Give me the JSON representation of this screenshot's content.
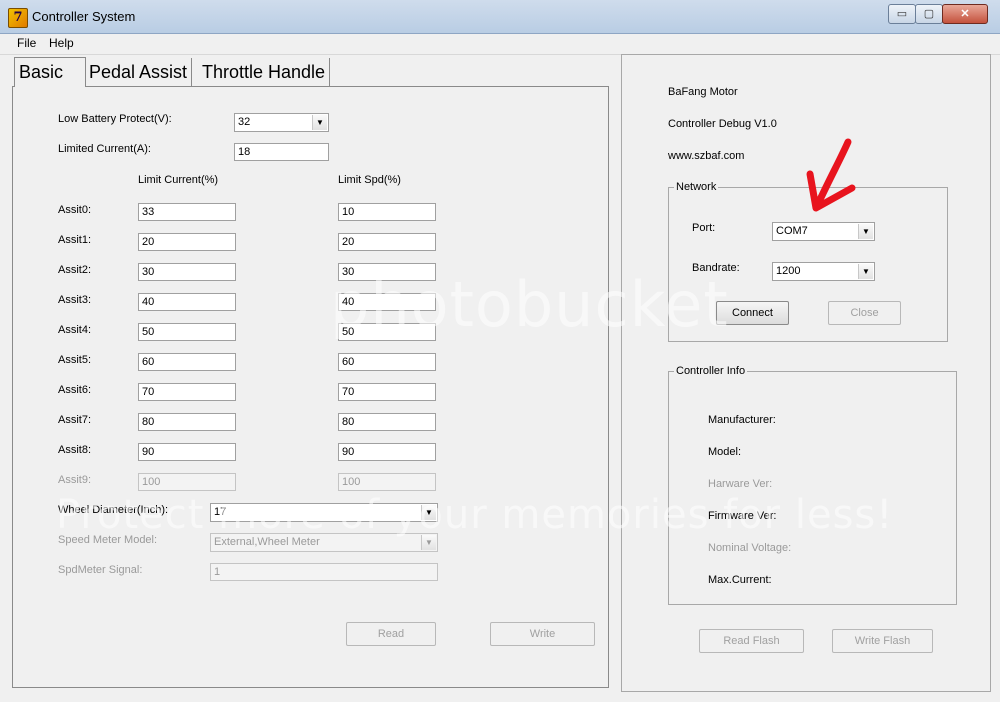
{
  "window": {
    "title": "Controller System",
    "min": "▭",
    "max": "▢",
    "close": "✕"
  },
  "menu": [
    "File",
    "Help"
  ],
  "tabs": [
    "Basic",
    "Pedal Assist",
    "Throttle Handle"
  ],
  "basic": {
    "low_battery_label": "Low Battery Protect(V):",
    "low_battery_value": "32",
    "limited_current_label": "Limited Current(A):",
    "limited_current_value": "18",
    "col_current": "Limit Current(%)",
    "col_speed": "Limit Spd(%)",
    "assist": [
      {
        "label": "Assit0:",
        "current": "33",
        "speed": "10"
      },
      {
        "label": "Assit1:",
        "current": "20",
        "speed": "20"
      },
      {
        "label": "Assit2:",
        "current": "30",
        "speed": "30"
      },
      {
        "label": "Assit3:",
        "current": "40",
        "speed": "40"
      },
      {
        "label": "Assit4:",
        "current": "50",
        "speed": "50"
      },
      {
        "label": "Assit5:",
        "current": "60",
        "speed": "60"
      },
      {
        "label": "Assit6:",
        "current": "70",
        "speed": "70"
      },
      {
        "label": "Assit7:",
        "current": "80",
        "speed": "80"
      },
      {
        "label": "Assit8:",
        "current": "90",
        "speed": "90"
      },
      {
        "label": "Assit9:",
        "current": "100",
        "speed": "100"
      }
    ],
    "wheel_label": "Wheel Diameter(Inch):",
    "wheel_value": "17",
    "speed_meter_label": "Speed Meter Model:",
    "speed_meter_value": "External,Wheel Meter",
    "spd_signal_label": "SpdMeter Signal:",
    "spd_signal_value": "1",
    "read_btn": "Read",
    "write_btn": "Write"
  },
  "info": {
    "line1": "BaFang Motor",
    "line2": "Controller Debug V1.0",
    "line3": "www.szbaf.com"
  },
  "network": {
    "title": "Network",
    "port_label": "Port:",
    "port_value": "COM7",
    "baud_label": "Bandrate:",
    "baud_value": "1200",
    "connect_btn": "Connect",
    "close_btn": "Close"
  },
  "controller_info": {
    "title": "Controller Info",
    "manufacturer": "Manufacturer:",
    "model": "Model:",
    "hardware": "Harware Ver:",
    "firmware": "Firmware Ver:",
    "voltage": "Nominal Voltage:",
    "current": "Max.Current:"
  },
  "flash": {
    "read": "Read Flash",
    "write": "Write Flash"
  },
  "annotation_color": "#e8141e",
  "watermark": {
    "text1": "photobucket",
    "text2": "Protect more of your memories for less!"
  }
}
